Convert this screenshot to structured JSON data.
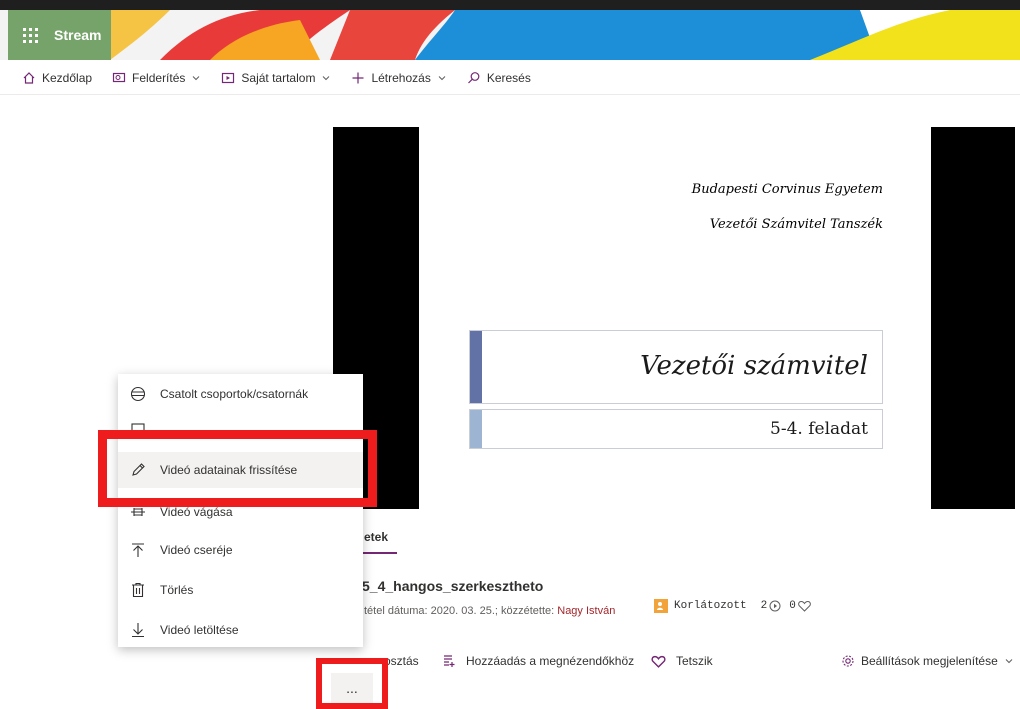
{
  "app": {
    "title": "Stream"
  },
  "nav": {
    "items": [
      {
        "label": "Kezdőlap",
        "icon": "home-icon"
      },
      {
        "label": "Felderítés",
        "icon": "discover-icon",
        "dropdown": true
      },
      {
        "label": "Saját tartalom",
        "icon": "my-content-icon",
        "dropdown": true
      },
      {
        "label": "Létrehozás",
        "icon": "plus-icon",
        "dropdown": true
      },
      {
        "label": "Keresés",
        "icon": "search-icon"
      }
    ]
  },
  "slide": {
    "university": "Budapesti Corvinus Egyetem",
    "department": "Vezetői Számvitel Tanszék",
    "title": "Vezetői számvitel",
    "subtitle": "5-4. feladat"
  },
  "details": {
    "tab_label": "etek",
    "video_title": "5_4_hangos_szerkesztheto",
    "meta_prefix": "tétel dátuma: 2020. 03. 25.; közzétette: ",
    "author": "Nagy István",
    "privacy": "Korlátozott",
    "views": "2",
    "likes": "0"
  },
  "actions": {
    "share": "osztás",
    "watchlist": "Hozzáadás a megnézendőkhöz",
    "like": "Tetszik",
    "settings": "Beállítások megjelenítése",
    "more": "..."
  },
  "menu": {
    "items": [
      {
        "label": "Csatolt csoportok/csatornák",
        "icon": "groups-icon"
      },
      {
        "label": "",
        "icon": "hidden-icon"
      },
      {
        "label": "Videó adatainak frissítése",
        "icon": "pencil-icon",
        "active": true
      },
      {
        "label": "Videó vágása",
        "icon": "trim-icon"
      },
      {
        "label": "Videó cseréje",
        "icon": "upload-arrow-icon"
      },
      {
        "label": "Törlés",
        "icon": "trash-icon"
      },
      {
        "label": "Videó letöltése",
        "icon": "download-arrow-icon"
      }
    ]
  },
  "colors": {
    "brand_green": "#76a36a",
    "accent_purple": "#742774",
    "highlight_red": "#ee1c1c",
    "author_red": "#a4262c"
  }
}
